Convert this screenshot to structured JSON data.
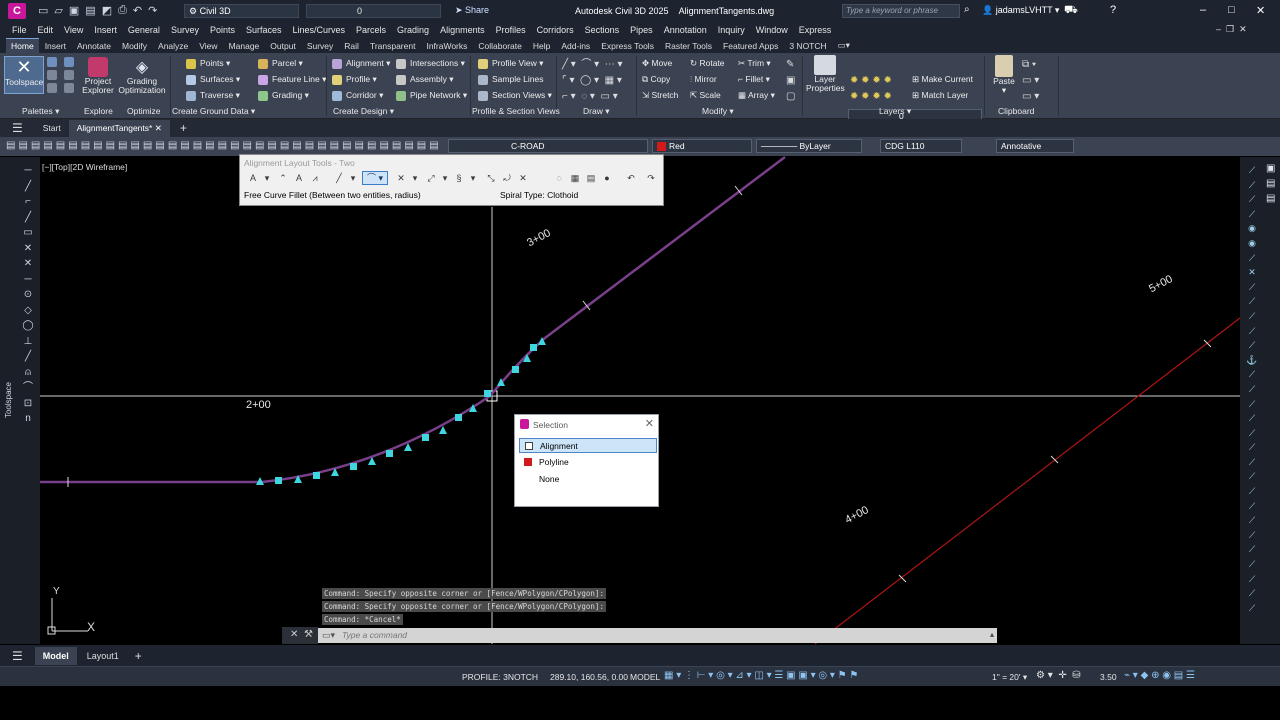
{
  "app": {
    "logo": "C",
    "workspace": "Civil 3D",
    "layer_quick": "0",
    "share_label": "Share",
    "product": "Autodesk Civil 3D 2025",
    "filename": "AlignmentTangents.dwg",
    "search_placeholder": "Type a keyword or phrase",
    "user": "jadamsLVHTT"
  },
  "menu": [
    "File",
    "Edit",
    "View",
    "Insert",
    "General",
    "Survey",
    "Points",
    "Surfaces",
    "Lines/Curves",
    "Parcels",
    "Grading",
    "Alignments",
    "Profiles",
    "Corridors",
    "Sections",
    "Pipes",
    "Annotation",
    "Inquiry",
    "Window",
    "Express"
  ],
  "ribbon_tabs": [
    "Home",
    "Insert",
    "Annotate",
    "Modify",
    "Analyze",
    "View",
    "Manage",
    "Output",
    "Survey",
    "Rail",
    "Transparent",
    "InfraWorks",
    "Collaborate",
    "Help",
    "Add-ins",
    "Express Tools",
    "Raster Tools",
    "Featured Apps",
    "3 NOTCH"
  ],
  "ribbon": {
    "toolspace": "Toolspace",
    "project_explorer": "Project\nExplorer",
    "grading_opt": "Grading\nOptimization",
    "ground_data": [
      "Points",
      "Surfaces",
      "Traverse",
      "Parcel",
      "Feature Line",
      "Grading"
    ],
    "design": [
      "Alignment",
      "Profile",
      "Corridor",
      "Intersections",
      "Assembly",
      "Pipe Network"
    ],
    "views": [
      "Profile View",
      "Sample Lines",
      "Section Views"
    ],
    "modify": [
      "Move",
      "Copy",
      "Stretch",
      "Rotate",
      "Mirror",
      "Scale",
      "Trim",
      "Fillet",
      "Array"
    ],
    "layer_props": "Layer\nProperties",
    "layer_value": "0",
    "make_current": "Make Current",
    "match_layer": "Match Layer",
    "paste": "Paste",
    "panels": [
      "Palettes",
      "Explore",
      "Optimize",
      "Create Ground Data",
      "Create Design",
      "Profile & Section Views",
      "Draw",
      "Modify",
      "Layers",
      "Clipboard"
    ]
  },
  "file_tabs": [
    "Start",
    "AlignmentTangents*"
  ],
  "propbar": {
    "layer": "C-ROAD",
    "color": "Red",
    "linetype": "ByLayer",
    "textstyle": "CDG L110",
    "annoscale": "Annotative"
  },
  "viewport_label": "[−][Top][2D Wireframe]",
  "alignment_tools": {
    "title": "Alignment Layout Tools - Two",
    "tool_label": "Free Curve Fillet (Between two entities, radius)",
    "spiral_label": "Spiral Type: Clothoid"
  },
  "stations": [
    "2+00",
    "3+00",
    "4+00",
    "5+00"
  ],
  "ucs": {
    "x": "X",
    "y": "Y"
  },
  "selection_dialog": {
    "title": "Selection",
    "options": [
      {
        "label": "Alignment",
        "color": "#ffffff"
      },
      {
        "label": "Polyline",
        "color": "#d11a1a"
      },
      {
        "label": "None",
        "color": ""
      }
    ]
  },
  "command_history": [
    "Command: Specify opposite corner or [Fence/WPolygon/CPolygon]:",
    "Command: Specify opposite corner or [Fence/WPolygon/CPolygon]:",
    "Command: *Cancel*"
  ],
  "command_placeholder": "Type a command",
  "layout_tabs": [
    "Model",
    "Layout1"
  ],
  "status": {
    "profile": "PROFILE: 3NOTCH",
    "coords": "289.10, 160.56, 0.00",
    "model": "MODEL",
    "annoscale": "1\" = 20'",
    "linewidth": "3.50"
  },
  "colors": {
    "alignment": "#7a3f8a",
    "polyline": "#b01515",
    "grips": "#3fd6e0"
  }
}
